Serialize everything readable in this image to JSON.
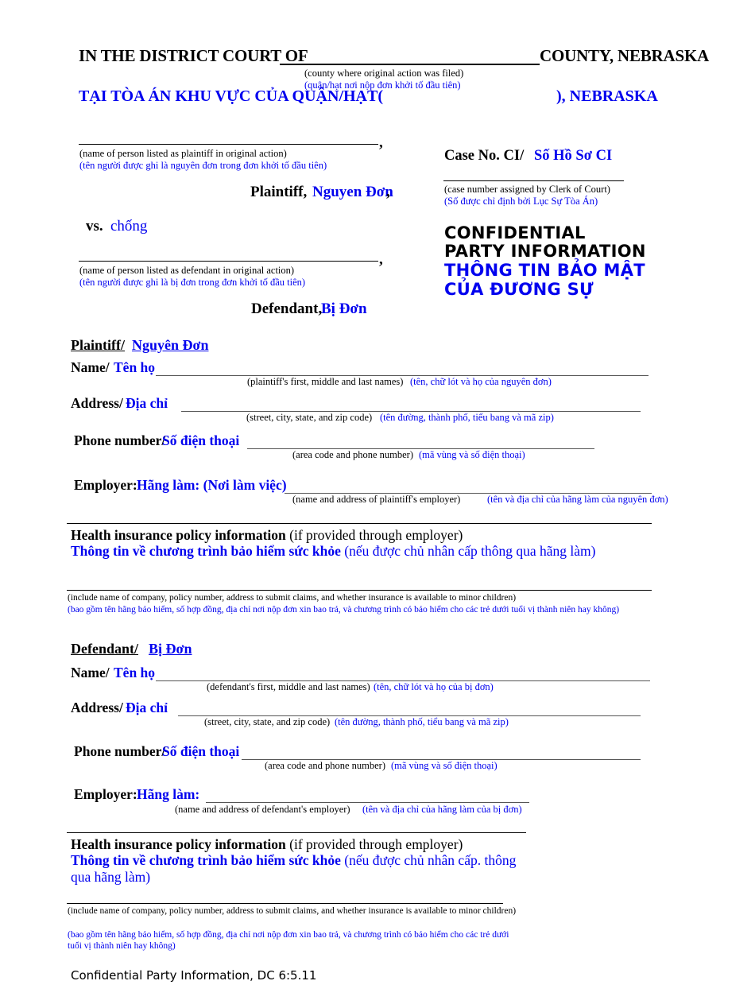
{
  "document": {
    "header": {
      "court_line_prefix": "IN THE DISTRICT COURT OF",
      "court_line_suffix": "COUNTY, NEBRASKA",
      "county_caption_en": "(county where original action was filed)",
      "county_caption_vi": "(quận/hạt nơi nộp đơn khởi tố đầu tiên)",
      "court_line_vi_prefix": "TẠI TÒA ÁN KHU VỰC CỦA QUẬN/HẠT(",
      "court_line_vi_suffix": "), NEBRASKA"
    },
    "caption": {
      "plaintiff_caption_en": "(name of person listed as plaintiff in original action)",
      "plaintiff_caption_vi": "(tên người được ghi là nguyên đơn trong đơn khởi tố đầu tiên)",
      "plaintiff_role_en": "Plaintiff,",
      "plaintiff_role_vi": "Nguyen Đơn",
      "plaintiff_role_comma": ",",
      "vs_en": "vs.",
      "vs_vi": "chống",
      "defendant_caption_en": "(name of person listed as defendant in original action)",
      "defendant_caption_vi": "(tên người được ghi là bị đơn trong đơn khởi tố đầu tiên)",
      "defendant_role_en": "Defendant,",
      "defendant_role_vi": "Bị Đơn",
      "comma": ","
    },
    "case_block": {
      "case_no_en": "Case No. CI/",
      "case_no_vi": "Số Hồ Sơ CI",
      "case_caption_en": "(case number assigned by Clerk of Court)",
      "case_caption_vi": "(Số được chỉ định bởi Lục Sự Tòa Án)",
      "title_en_line1": "CONFIDENTIAL",
      "title_en_line2": "PARTY INFORMATION",
      "title_vi_line1": "THÔNG TIN BẢO MẬT",
      "title_vi_line2": "CỦA ĐƯƠNG SỰ"
    },
    "plaintiff_section": {
      "heading_en": "Plaintiff/",
      "heading_vi": "Nguyên Đơn",
      "name_label_en": "Name/",
      "name_label_vi": "Tên họ",
      "name_caption_en": "(plaintiff's first, middle and last names)",
      "name_caption_vi": "(tên, chữ lót và họ của nguyên đơn)",
      "address_label_en": "Address/",
      "address_label_vi": "Địa chỉ",
      "address_caption_en": "(street, city, state, and zip code)",
      "address_caption_vi": "(tên đường, thành phố, tiểu bang và mã zip)",
      "phone_label_en": "Phone number/",
      "phone_label_vi": "Số điện thoại",
      "phone_caption_en": "(area code and phone number)",
      "phone_caption_vi": "(mã vùng và số điện thoại)",
      "employer_label_en": "Employer:",
      "employer_label_vi": "Hãng làm: (Nơi làm việc)",
      "employer_caption_en": "(name and address of plaintiff's employer)",
      "employer_caption_vi": "(tên và địa chỉ của hãng làm của nguyên đơn)",
      "health_en_bold": "Health insurance policy information",
      "health_en_rest": " (if provided through employer)",
      "health_vi_bold": "Thông tin về chương trình bảo hiểm sức khỏe",
      "health_vi_rest": " (nếu được chủ nhân cấp thông qua hãng làm)",
      "health_caption_en": "(include name of company, policy number, address to submit claims, and whether insurance is available to minor children)",
      "health_caption_vi": "(bao gồm tên hãng bảo hiểm, số hợp đồng, địa chỉ nơi nộp đơn xin bao trả, và chương trình có bảo hiểm cho các trẻ dưới tuổi vị thành niên hay không)"
    },
    "defendant_section": {
      "heading_en": "Defendant/",
      "heading_vi": "Bị Đơn",
      "name_label_en": "Name/",
      "name_label_vi": "Tên họ",
      "name_caption_en": "(defendant's first, middle and last names)",
      "name_caption_vi": "(tên, chữ lót và họ của bị đơn)",
      "address_label_en": "Address/",
      "address_label_vi": "Địa chỉ",
      "address_caption_en": "(street, city, state, and zip code)",
      "address_caption_vi": "(tên đường, thành phố, tiểu bang và mã zip)",
      "phone_label_en": "Phone number/",
      "phone_label_vi": "Số điện thoại",
      "phone_caption_en": "(area code and phone number)",
      "phone_caption_vi": "(mã vùng và số điện thoại)",
      "employer_label_en": "Employer:",
      "employer_label_vi": "Hãng làm:",
      "employer_caption_en": "(name and address of defendant's employer)",
      "employer_caption_vi": "(tên và địa chỉ của hãng làm của bị đơn)",
      "health_en_bold": "Health insurance policy information",
      "health_en_rest": " (if provided through employer)",
      "health_vi_bold": "Thông tin về chương trình bảo hiểm sức khỏe",
      "health_vi_rest": " (nếu được chủ nhân cấp. thông qua hãng làm)",
      "health_caption_en": "(include name of company, policy number, address to submit claims, and whether insurance is available to minor children)",
      "health_caption_vi": "(bao gồm tên hãng bảo hiểm, số hợp đồng, địa chỉ nơi nộp đơn xin bao trả, và chương trình có bảo hiểm cho các trẻ dưới tuổi vị thành niên hay không)"
    },
    "footer": {
      "form_name": "Confidential Party Information, DC 6:5.11"
    },
    "colors": {
      "vietnamese_text": "#0000ee",
      "english_text": "#000000",
      "background": "#ffffff"
    }
  }
}
